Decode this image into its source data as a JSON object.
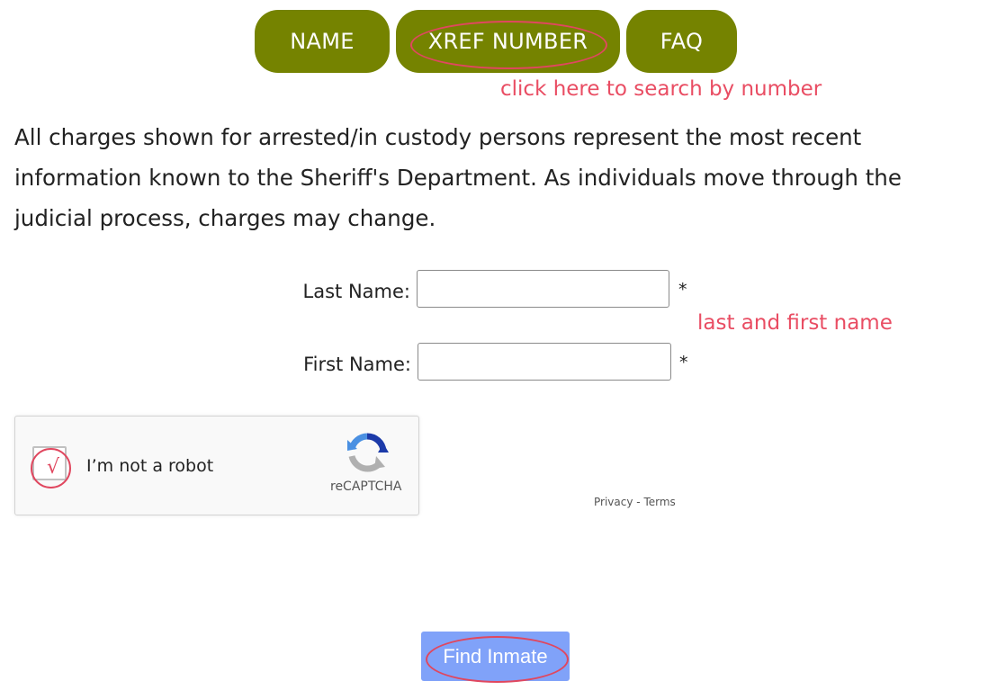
{
  "tabs": {
    "name": "NAME",
    "xref": "XREF NUMBER",
    "faq": "FAQ"
  },
  "annotations": {
    "xref_hint": "click here to search by number",
    "name_hint": "last and first name"
  },
  "disclaimer": "All charges shown for arrested/in custody persons represent the most recent information known to the Sheriff's Department. As individuals move through the judicial process, charges may change.",
  "form": {
    "last_name_label": "Last Name:",
    "last_name_value": "",
    "first_name_label": "First Name:",
    "first_name_value": "",
    "required_marker": "*"
  },
  "captcha": {
    "label": "I’m not a robot",
    "brand": "reCAPTCHA",
    "check_mark": "√",
    "privacy": "Privacy",
    "separator": "-",
    "terms": "Terms"
  },
  "submit": {
    "label": "Find Inmate"
  },
  "colors": {
    "tab_bg": "#758300",
    "annotation": "#e94d63",
    "submit_bg": "#80a2f9"
  }
}
